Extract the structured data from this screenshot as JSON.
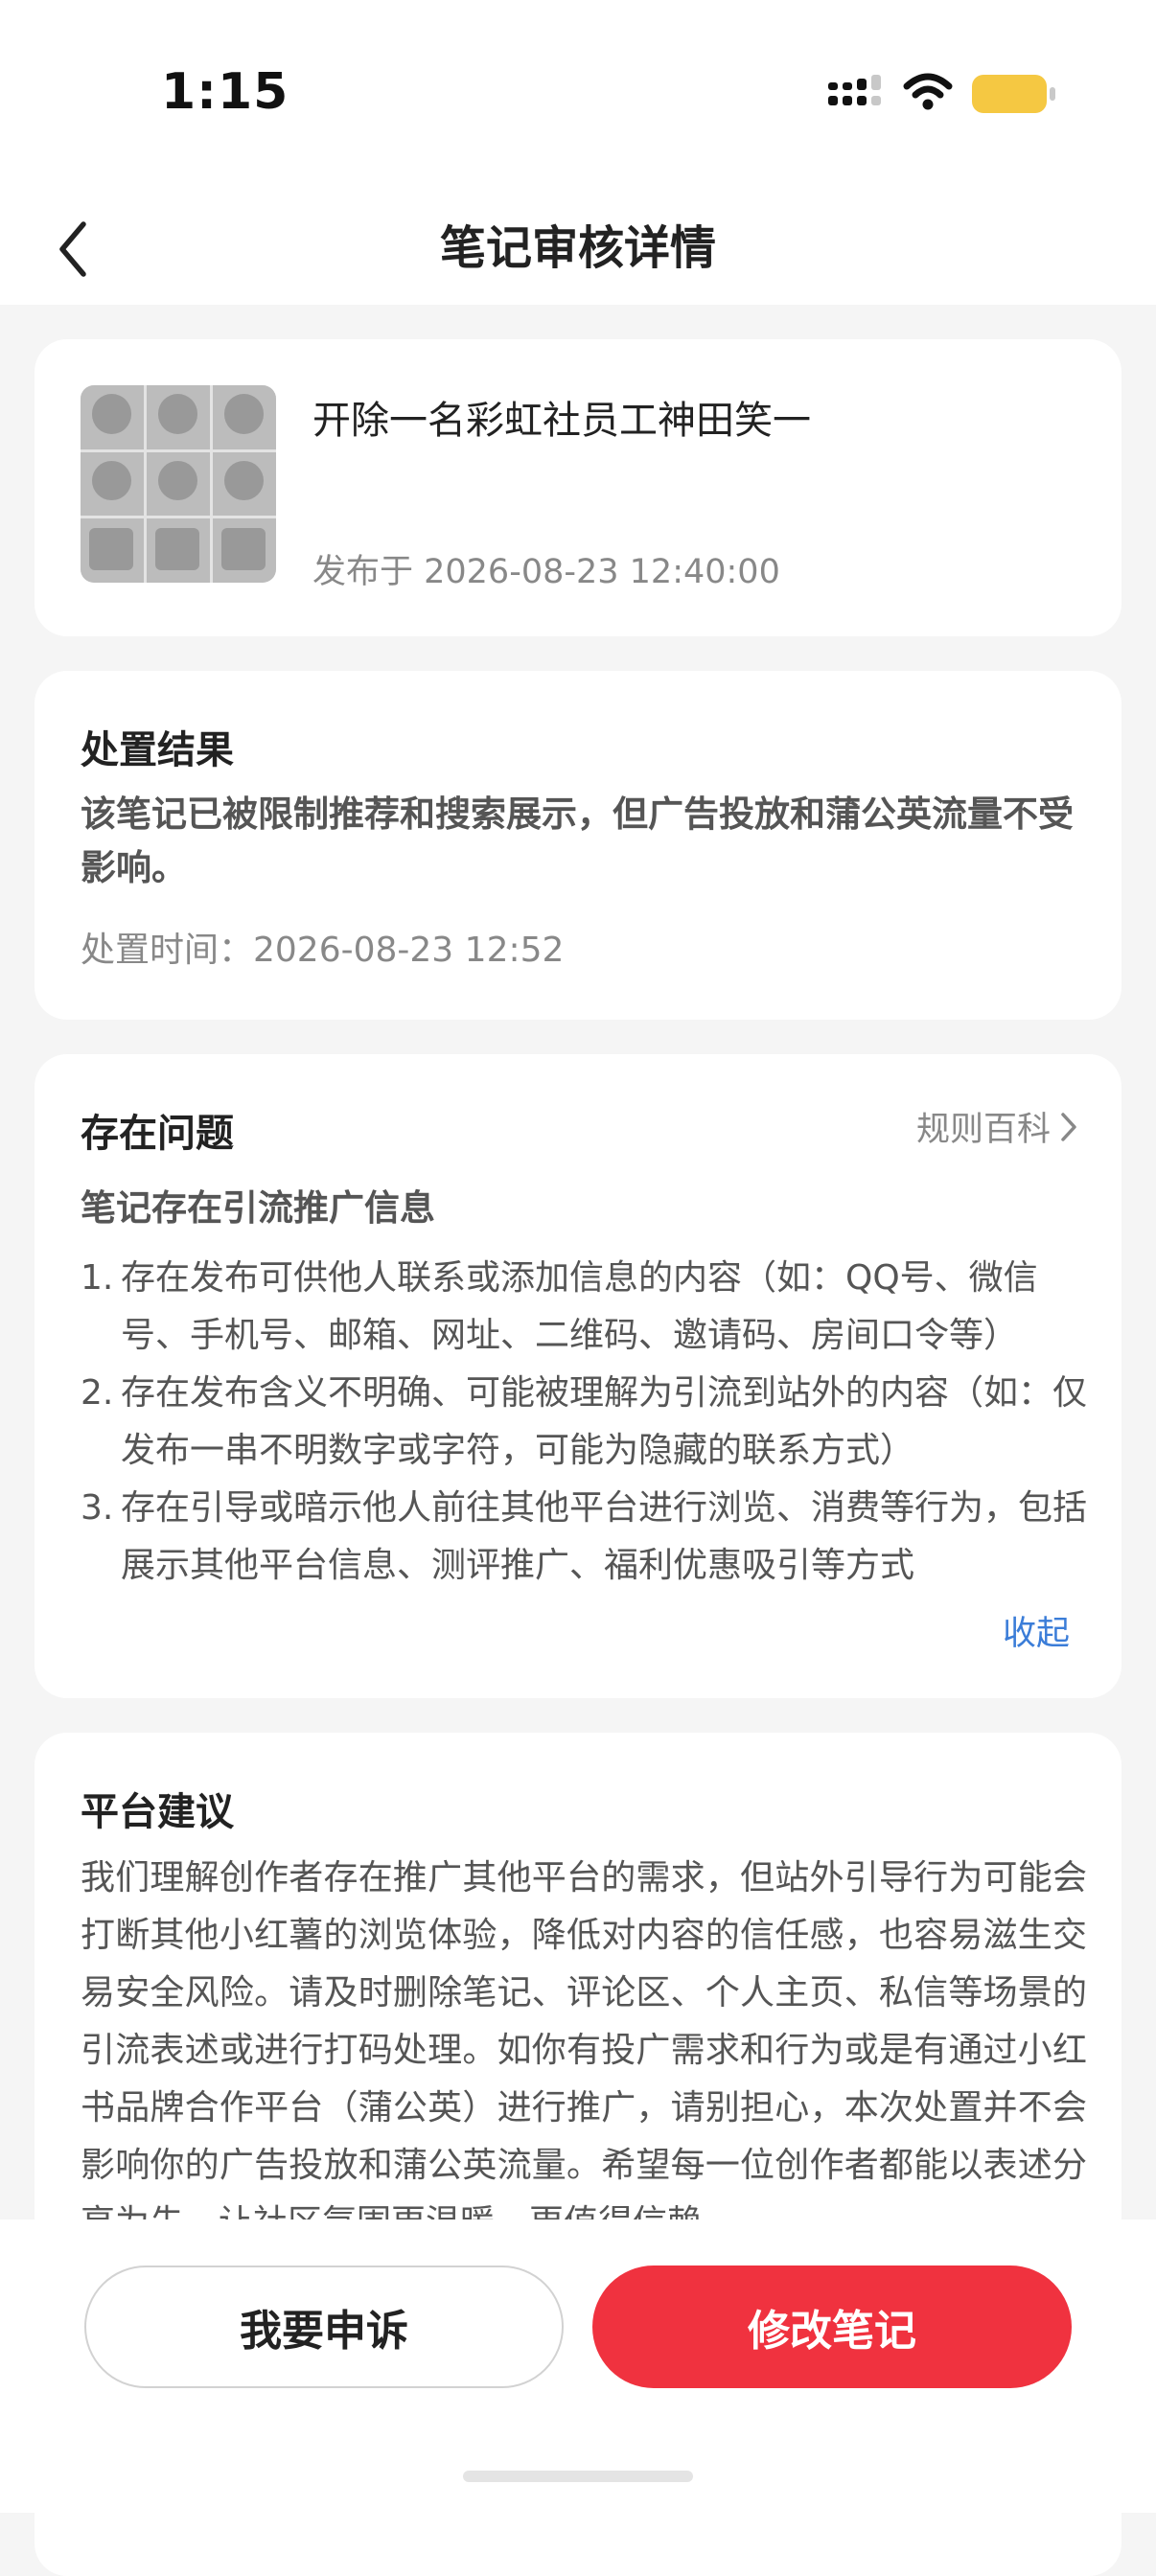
{
  "status_bar": {
    "time": "1:15",
    "icons": [
      "signal-icon",
      "wifi-icon",
      "battery-icon"
    ],
    "battery_color": "#f5c842"
  },
  "nav": {
    "title": "笔记审核详情",
    "back_icon": "chevron-left-icon"
  },
  "note": {
    "title": "开除一名彩虹社员工神田笑一",
    "published": "发布于 2026-08-23 12:40:00"
  },
  "result": {
    "title": "处置结果",
    "text": "该笔记已被限制推荐和搜索展示，但广告投放和蒲公英流量不受影响。",
    "time": "处置时间：2026-08-23 12:52"
  },
  "problem": {
    "title": "存在问题",
    "rules_link": "规则百科",
    "subtitle": "笔记存在引流推广信息",
    "items": [
      {
        "num": "1.",
        "text": "存在发布可供他人联系或添加信息的内容（如：QQ号、微信号、手机号、邮箱、网址、二维码、邀请码、房间口令等）"
      },
      {
        "num": "2.",
        "text": "存在发布含义不明确、可能被理解为引流到站外的内容（如：仅发布一串不明数字或字符，可能为隐藏的联系方式）"
      },
      {
        "num": "3.",
        "text": "存在引导或暗示他人前往其他平台进行浏览、消费等行为，包括展示其他平台信息、测评推广、福利优惠吸引等方式"
      }
    ],
    "collapse": "收起"
  },
  "advice": {
    "title": "平台建议",
    "text": "我们理解创作者存在推广其他平台的需求，但站外引导行为可能会打断其他小红薯的浏览体验，降低对内容的信任感，也容易滋生交易安全风险。请及时删除笔记、评论区、个人主页、私信等场景的引流表述或进行打码处理。如你有投广需求和行为或是有通过小红书品牌合作平台（蒲公英）进行推广，请别担心，本次处置并不会影响你的广告投放和蒲公英流量。希望每一位创作者都能以表述分享为先，让社区氛围更温暖，更值得信赖。"
  },
  "actions": {
    "appeal": "我要申诉",
    "edit": "修改笔记",
    "accent_color": "#f0323f"
  }
}
